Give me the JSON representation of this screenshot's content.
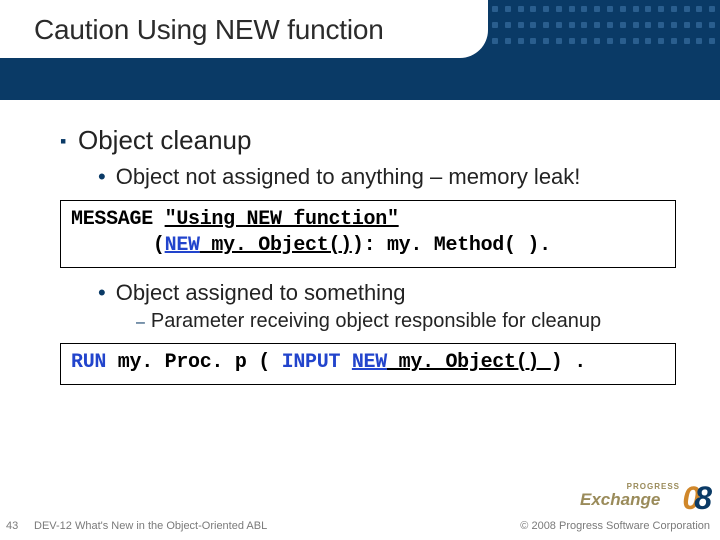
{
  "title": "Caution Using NEW function",
  "bullets": {
    "lvl1": "Object cleanup",
    "lvl2a": "Object not assigned to anything – memory leak!",
    "lvl2b": "Object assigned to something",
    "lvl3": "Parameter receiving object responsible for cleanup"
  },
  "code1": {
    "line1_pre": "MESSAGE ",
    "line1_str": "\"Using NEW function\"",
    "line2_indent": "       ",
    "line2_lparen": "(",
    "line2_new": "NEW",
    "line2_mid": " my. Object()",
    "line2_rparen": ")",
    "line2_tail": ": my. Method( )."
  },
  "code2": {
    "run": "RUN",
    "mid1": " my. Proc. p ( ",
    "input": "INPUT",
    "space": " ",
    "new": "NEW",
    "mid2": " my. Object() ",
    "rparen": ")",
    "tail": " ."
  },
  "footer": {
    "slide_num": "43",
    "left": "DEV-12 What's New in the Object-Oriented ABL",
    "right": "© 2008 Progress Software Corporation"
  },
  "logo": {
    "progress": "PROGRESS",
    "exchange": "Exchange",
    "zero": "0",
    "eight": "8"
  }
}
